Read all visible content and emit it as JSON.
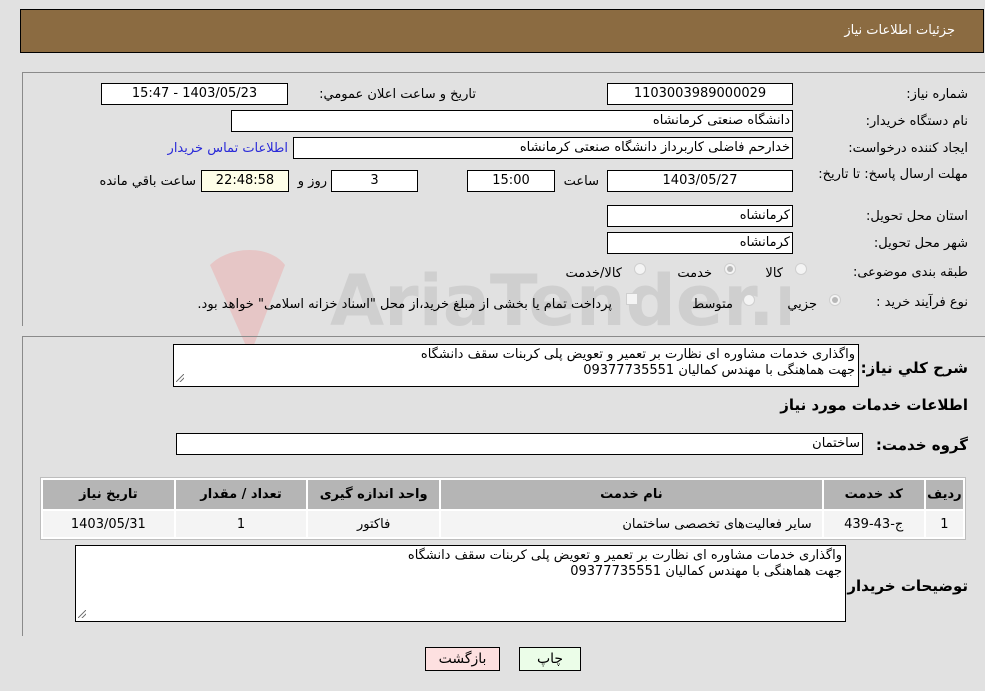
{
  "header": {
    "title": "جزئیات اطلاعات نیاز"
  },
  "form": {
    "need_number": {
      "label": "شماره نیاز:",
      "value": "1103003989000029"
    },
    "announce_datetime": {
      "label": "تاریخ و ساعت اعلان عمومي:",
      "value": "1403/05/23 - 15:47"
    },
    "buyer_org": {
      "label": "نام دستگاه خریدار:",
      "value": "دانشگاه صنعتی کرمانشاه"
    },
    "requester": {
      "label": "ایجاد کننده درخواست:",
      "value": "خدارحم فاضلی کاربرداز دانشگاه صنعتی کرمانشاه"
    },
    "buyer_contact_link": "اطلاعات تماس خریدار",
    "deadline": {
      "label": "مهلت ارسال پاسخ: تا تاریخ:",
      "date": "1403/05/27",
      "time_label": "ساعت",
      "time": "15:00",
      "days": "3",
      "days_label": "روز و",
      "remaining": "22:48:58",
      "remaining_label": "ساعت باقي مانده"
    },
    "province": {
      "label": "استان محل تحویل:",
      "value": "کرمانشاه"
    },
    "city": {
      "label": "شهر محل تحویل:",
      "value": "کرمانشاه"
    },
    "category": {
      "label": "طبقه بندی موضوعی:",
      "options": [
        "کالا",
        "خدمت",
        "کالا/خدمت"
      ],
      "selected": "خدمت"
    },
    "purchase_process": {
      "label": "نوع فرآیند خرید :",
      "options": [
        "جزيي",
        "متوسط"
      ],
      "selected": "جزيي",
      "treasury_note": "پرداخت تمام یا بخشی از مبلغ خرید،از محل \"اسناد خزانه اسلامی\" خواهد بود."
    }
  },
  "details": {
    "general_desc_label": "شرح کلي نياز:",
    "general_desc": "واگذاری خدمات مشاوره ای نظارت بر تعمیر و تعویض پلی کربنات سقف دانشگاه\nجهت هماهنگی با مهندس کمالیان 09377735551",
    "services_title": "اطلاعات خدمات مورد نياز",
    "service_group_label": "گروه خدمت:",
    "service_group": "ساختمان",
    "table": {
      "headers": [
        "رديف",
        "کد خدمت",
        "نام خدمت",
        "واحد اندازه گیری",
        "تعداد / مقدار",
        "تاریخ نیاز"
      ],
      "rows": [
        [
          "1",
          "ج-43-439",
          "سایر فعالیت‌های تخصصی ساختمان",
          "فاکتور",
          "1",
          "1403/05/31"
        ]
      ]
    },
    "buyer_notes_label": "توضیحات خریدار:",
    "buyer_notes": "واگذاری خدمات مشاوره ای نظارت بر تعمیر و تعویض پلی کربنات سقف دانشگاه\nجهت هماهنگی با مهندس کمالیان 09377735551"
  },
  "buttons": {
    "print": "چاپ",
    "back": "بازگشت"
  },
  "watermark": "AriaTender.neT"
}
